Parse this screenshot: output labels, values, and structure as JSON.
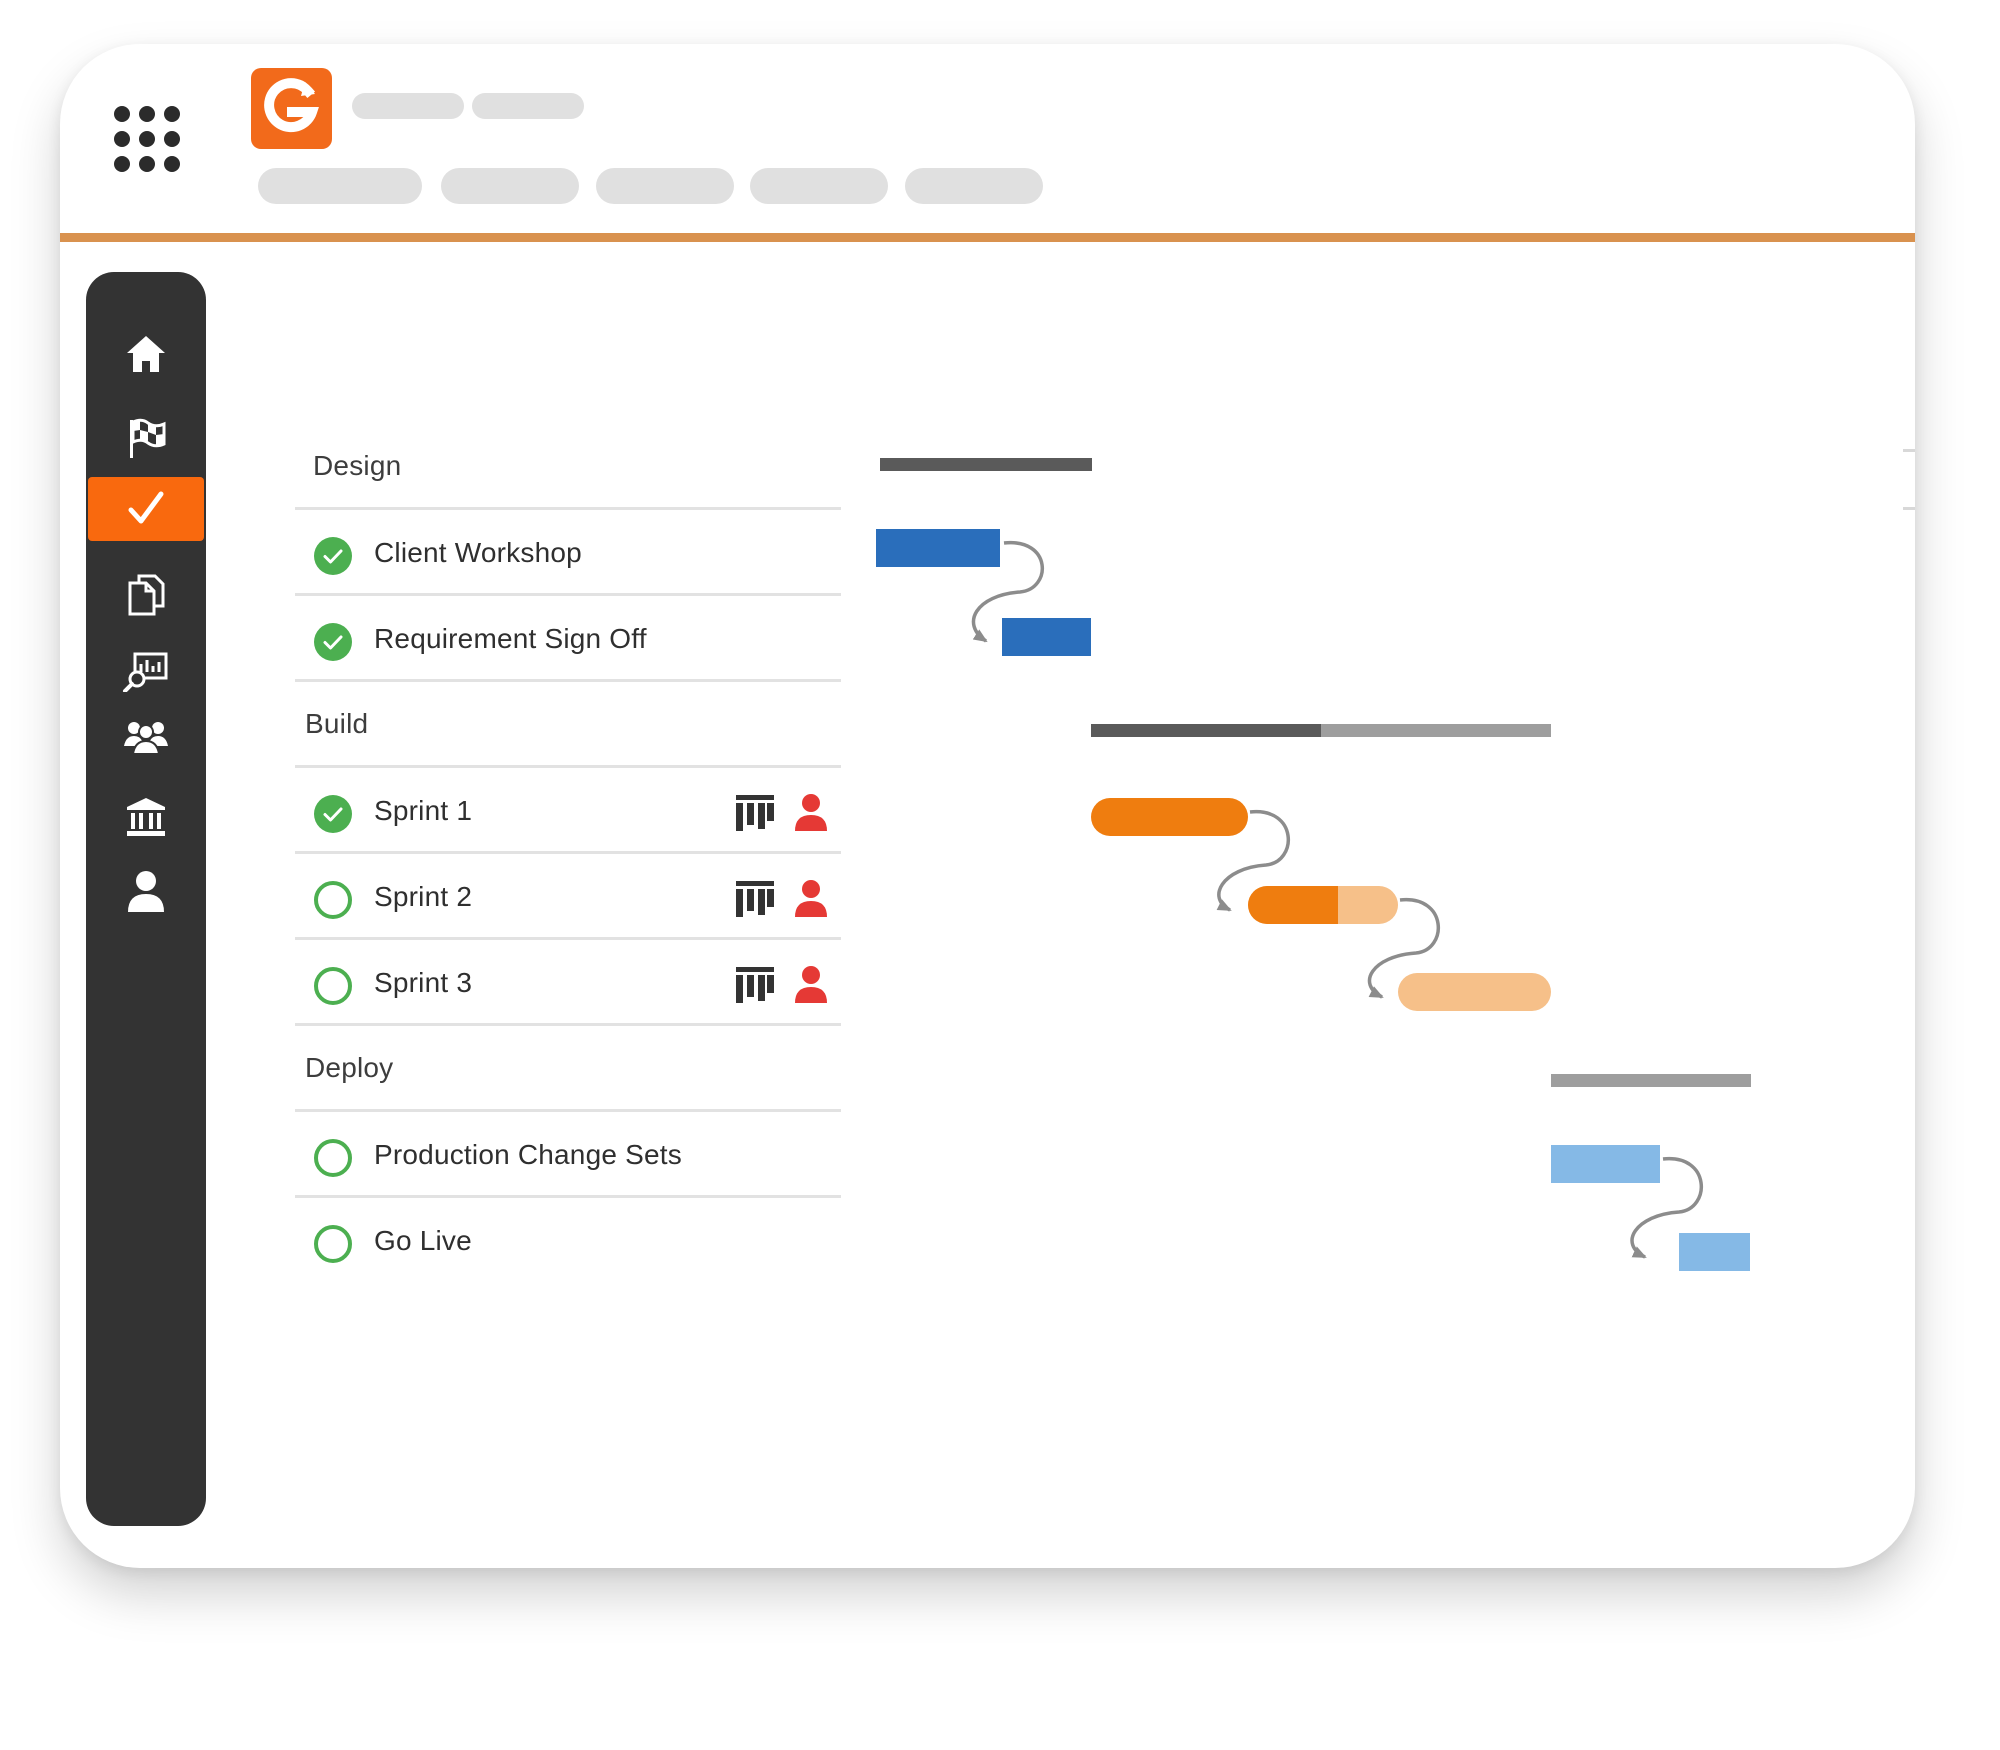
{
  "app": {
    "logo_letter": "G",
    "brand_color": "#f26a1b",
    "accent_line_color": "#d9924f"
  },
  "sidebar": {
    "items": [
      {
        "name": "home-icon",
        "active": false
      },
      {
        "name": "flag-icon",
        "active": false
      },
      {
        "name": "checkmark-icon",
        "active": true
      },
      {
        "name": "documents-icon",
        "active": false
      },
      {
        "name": "search-report-icon",
        "active": false
      },
      {
        "name": "team-icon",
        "active": false
      },
      {
        "name": "bank-icon",
        "active": false
      },
      {
        "name": "user-icon",
        "active": false
      }
    ]
  },
  "tasks": {
    "groups": [
      {
        "label": "Design",
        "items": [
          {
            "label": "Client Workshop",
            "status": "complete"
          },
          {
            "label": "Requirement Sign Off",
            "status": "complete"
          }
        ]
      },
      {
        "label": "Build",
        "items": [
          {
            "label": "Sprint 1",
            "status": "complete"
          },
          {
            "label": "Sprint 2",
            "status": "open"
          },
          {
            "label": "Sprint 3",
            "status": "open"
          }
        ]
      },
      {
        "label": "Deploy",
        "items": [
          {
            "label": "Production Change Sets",
            "status": "open"
          },
          {
            "label": "Go Live",
            "status": "open"
          }
        ]
      }
    ]
  },
  "gantt": {
    "summary_dark": "#5a5a5a",
    "summary_light": "#9e9e9e",
    "design_color": "#2a6ebb",
    "build_color": "#ef7d0f",
    "build_light_color": "#f6c089",
    "deploy_color": "#85b9e6",
    "status_complete_color": "#4caf50",
    "assignee_color": "#e53935"
  }
}
